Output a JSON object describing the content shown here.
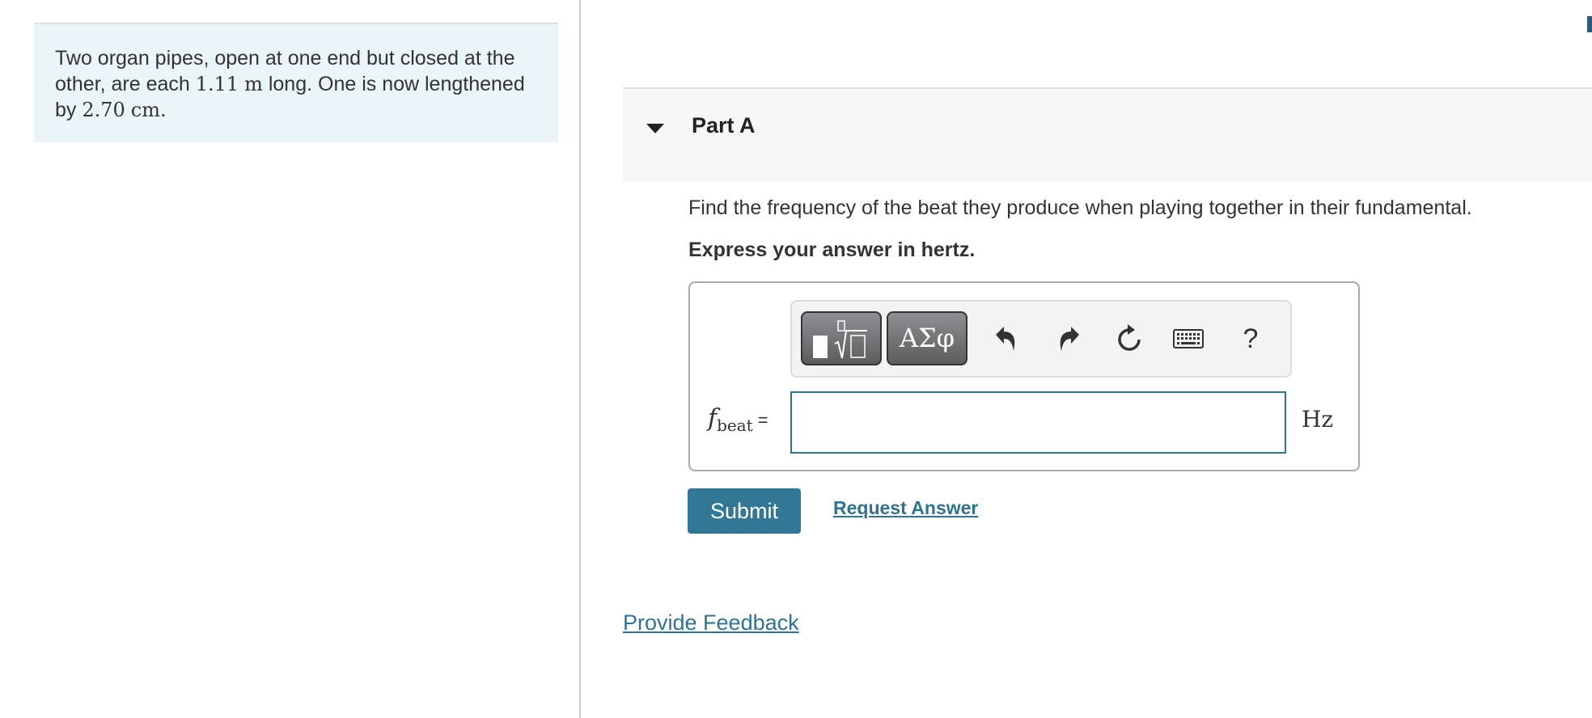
{
  "problem": {
    "text_before_length": "Two organ pipes, open at one end but closed at the other, are each ",
    "length_value": "1.11",
    "length_unit": "m",
    "text_middle": " long. One is now lengthened by ",
    "extension_value": "2.70",
    "extension_unit": "cm",
    "text_end": "."
  },
  "part": {
    "toggle_icon": "caret-down-icon",
    "title": "Part A",
    "question": "Find the frequency of the beat they produce when playing together in their fundamental.",
    "instruction": "Express your answer in hertz."
  },
  "toolbar": {
    "templates_icon": "templates-sqrt-icon",
    "symbols_label": "ΑΣφ",
    "undo_icon": "undo-icon",
    "redo_icon": "redo-icon",
    "reset_icon": "reset-icon",
    "keyboard_icon": "keyboard-icon",
    "help_label": "?"
  },
  "answer": {
    "variable": "f",
    "subscript": "beat",
    "equals": "=",
    "value": "",
    "placeholder": "",
    "unit": "Hz"
  },
  "actions": {
    "submit_label": "Submit",
    "request_answer_label": "Request Answer",
    "provide_feedback_label": "Provide Feedback"
  },
  "colors": {
    "accent": "#337797",
    "link": "#2f7391",
    "problem_bg": "#e9f5f7",
    "part_header_bg": "#f7f7f7"
  }
}
